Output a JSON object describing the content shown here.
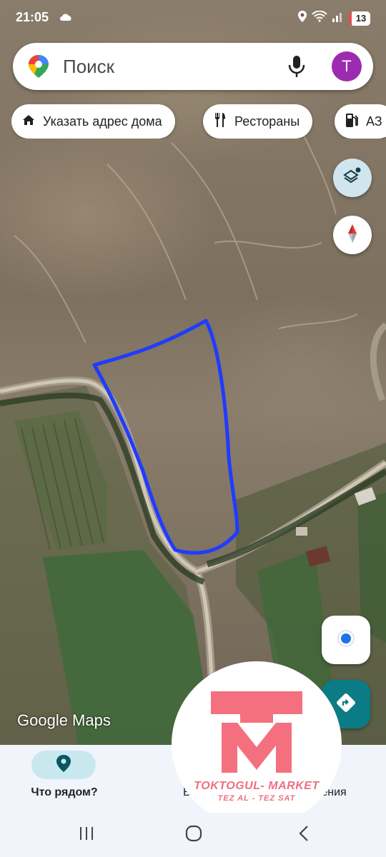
{
  "status_bar": {
    "time": "21:05",
    "battery": "13"
  },
  "search": {
    "placeholder": "Поиск",
    "avatar_letter": "T"
  },
  "chips": [
    {
      "label": "Указать адрес дома",
      "icon": "home-icon"
    },
    {
      "label": "Рестораны",
      "icon": "restaurant-icon"
    },
    {
      "label": "АЗ",
      "icon": "gas-station-icon"
    }
  ],
  "map": {
    "attribution": "Google Maps",
    "outline_color": "#1f3cff"
  },
  "bottom_nav": {
    "nearby_label": "Что рядом?",
    "second_label_clip": "В",
    "third_label_clip": "ления"
  },
  "watermark": {
    "brand": "TOKTOGUL- MARKET",
    "tagline": "TEZ AL - TEZ SAT",
    "color": "#ee6f82"
  },
  "colors": {
    "accent": "#0b7b85",
    "avatar": "#9c2bb0",
    "nav_bg": "#f1f5fb"
  }
}
